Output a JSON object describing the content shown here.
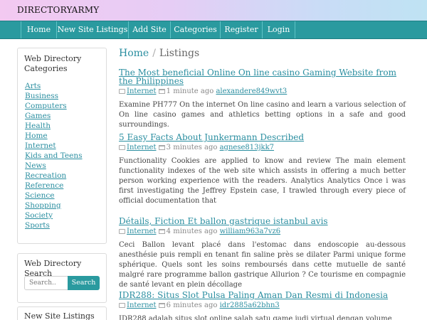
{
  "brand": "DIRECTORYARMY",
  "nav": [
    "Home",
    "New Site Listings",
    "Add Site",
    "Categories",
    "Register",
    "Login"
  ],
  "sidebar": {
    "categories_title": "Web Directory Categories",
    "categories": [
      "Arts",
      "Business",
      "Computers",
      "Games",
      "Health",
      "Home",
      "Internet",
      "Kids and Teens",
      "News",
      "Recreation",
      "Reference",
      "Science",
      "Shopping",
      "Society",
      "Sports"
    ],
    "search_title": "Web Directory Search",
    "search_placeholder": "Search..",
    "search_button": "Search",
    "new_listings_title": "New Site Listings"
  },
  "breadcrumb": {
    "home": "Home",
    "sep": "/",
    "current": "Listings"
  },
  "listings": [
    {
      "title": "The Most beneficial Online On line casino Gaming Website from the Philippines",
      "category": "Internet",
      "time": "1 minute ago",
      "user": "alexandere849wvt3",
      "desc": "Examine PH777 On the internet On line casino and learn a various selection of On line casino games and athletics betting options in a safe and good surroundings."
    },
    {
      "title": "5 Easy Facts About Junkermann Described",
      "category": "Internet",
      "time": "3 minutes ago",
      "user": "agnese813jkk7",
      "desc": "Functionality Cookies are applied to know and review The main element functionality indexes of the web site which assists in offering a much better person working experience with the readers. Analytics Analytics Once i was first investigating the Jeffrey Epstein case, I trawled through every piece of official documentation that"
    },
    {
      "title": "Détails, Fiction Et ballon gastrique istanbul avis",
      "category": "Internet",
      "time": "4 minutes ago",
      "user": "william963a7vz6",
      "desc": "Ceci Ballon levant placé dans l'estomac dans endoscopie au-dessous anesthésie puis rempli en tenant fin saline près se dilater Parmi unique forme sphérique. Quels sont les soins remboursés dans cette mutuelle de santé malgré rare programme ballon gastrique Allurion ? Ce tourisme en compagnie de santé levant en plein décollage"
    },
    {
      "title": "IDR288: Situs Slot Pulsa Paling Aman Dan Resmi di Indonesia",
      "category": "Internet",
      "time": "6 minutes ago",
      "user": "idr2885a62bhn3",
      "desc": "IDR288 adalah situs slot online salah satu game judi virtual dengan volume"
    }
  ]
}
